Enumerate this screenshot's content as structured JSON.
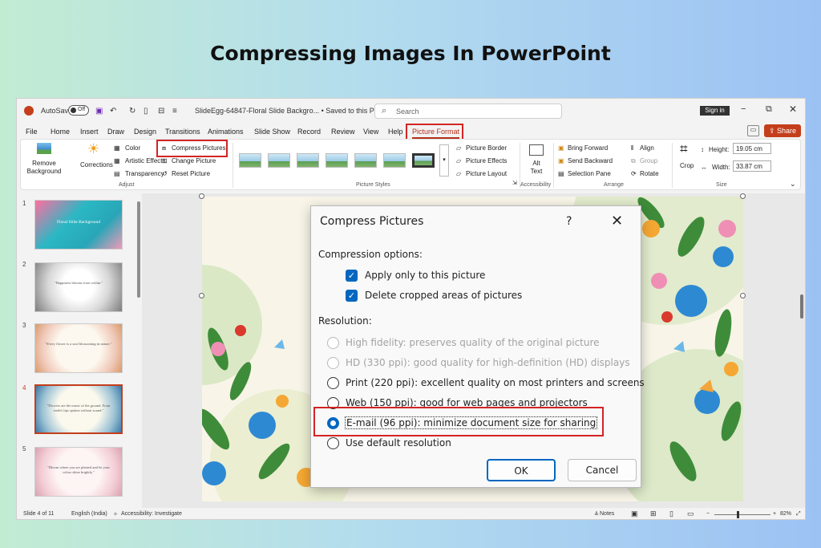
{
  "headline": "Compressing Images In PowerPoint",
  "titlebar": {
    "autosave_label": "AutoSave",
    "autosave_state": "Off",
    "filename": "SlideEgg-64847-Floral Slide Backgro... • Saved to this PC",
    "search_placeholder": "Search",
    "signin_label": "Sign in"
  },
  "tabs": [
    "File",
    "Home",
    "Insert",
    "Draw",
    "Design",
    "Transitions",
    "Animations",
    "Slide Show",
    "Record",
    "Review",
    "View",
    "Help",
    "Picture Format"
  ],
  "share_label": "Share",
  "ribbon": {
    "remove_background": [
      "Remove",
      "Background"
    ],
    "corrections": "Corrections",
    "color": "Color",
    "artistic_effects": "Artistic Effects",
    "transparency": "Transparency",
    "compress_pictures": "Compress Pictures",
    "change_picture": "Change Picture",
    "reset_picture": "Reset Picture",
    "adjust_group": "Adjust",
    "picture_styles_group": "Picture Styles",
    "picture_border": "Picture Border",
    "picture_effects": "Picture Effects",
    "picture_layout": "Picture Layout",
    "alt_text": [
      "Alt",
      "Text"
    ],
    "accessibility_group": "Accessibility",
    "bring_forward": "Bring Forward",
    "send_backward": "Send Backward",
    "selection_pane": "Selection Pane",
    "align": "Align",
    "group": "Group",
    "rotate": "Rotate",
    "arrange_group": "Arrange",
    "crop": "Crop",
    "height_label": "Height:",
    "height_value": "19.05 cm",
    "width_label": "Width:",
    "width_value": "33.87 cm",
    "size_group": "Size"
  },
  "slides": [
    {
      "num": "1",
      "text": "Floral Slide Background"
    },
    {
      "num": "2",
      "text": "\"Happiness blooms from within.\""
    },
    {
      "num": "3",
      "text": "\"Every flower is a soul blossoming in nature.\""
    },
    {
      "num": "4",
      "text": "\"Flowers are the music of the ground. From earth's lips spoken without sound.\""
    },
    {
      "num": "5",
      "text": "\"Bloom where you are planted and let your colors shine brightly.\""
    }
  ],
  "dialog": {
    "title": "Compress Pictures",
    "help": "?",
    "close": "✕",
    "compression_options_label": "Compression options:",
    "apply_only": "Apply only to this picture",
    "delete_cropped": "Delete cropped areas of pictures",
    "resolution_label": "Resolution:",
    "options": [
      {
        "label": "High fidelity: preserves quality of the original picture",
        "state": "disabled"
      },
      {
        "label": "HD (330 ppi): good quality for high-definition (HD) displays",
        "state": "disabled"
      },
      {
        "label": "Print (220 ppi): excellent quality on most printers and screens",
        "state": "enabled"
      },
      {
        "label": "Web (150 ppi): good for web pages and projectors",
        "state": "enabled"
      },
      {
        "label": "E-mail (96 ppi): minimize document size for sharing",
        "state": "selected"
      },
      {
        "label": "Use default resolution",
        "state": "enabled"
      }
    ],
    "ok": "OK",
    "cancel": "Cancel"
  },
  "status": {
    "slide_count": "Slide 4 of 11",
    "language": "English (India)",
    "accessibility": "Accessibility: Investigate",
    "notes": "Notes",
    "zoom": "82%"
  },
  "colors": {
    "highlight": "#d32424",
    "accent": "#0067c0",
    "share": "#c43e1c"
  }
}
